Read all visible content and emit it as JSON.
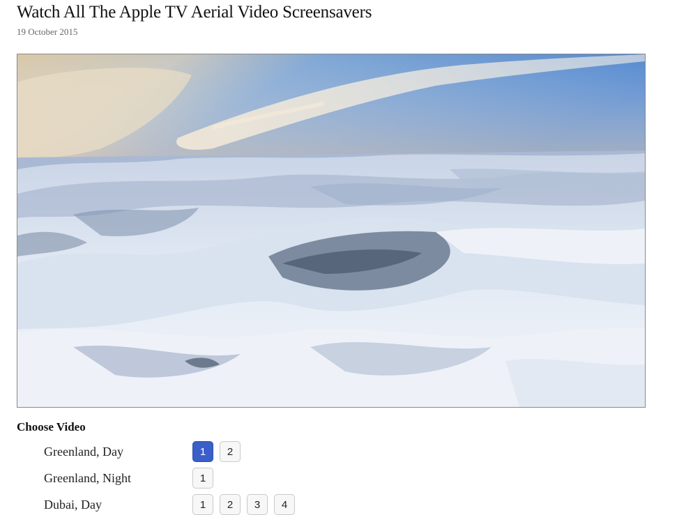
{
  "article": {
    "title": "Watch All The Apple TV Aerial Video Screensavers",
    "date": "19 October 2015"
  },
  "player": {
    "image_subject": "aerial-snowy-mountains"
  },
  "chooser": {
    "heading": "Choose Video",
    "active_color": "#3a5fc8",
    "rows": [
      {
        "label": "Greenland, Day",
        "buttons": [
          "1",
          "2"
        ],
        "active": "1"
      },
      {
        "label": "Greenland, Night",
        "buttons": [
          "1"
        ],
        "active": null
      },
      {
        "label": "Dubai, Day",
        "buttons": [
          "1",
          "2",
          "3",
          "4"
        ],
        "active": null
      }
    ]
  }
}
